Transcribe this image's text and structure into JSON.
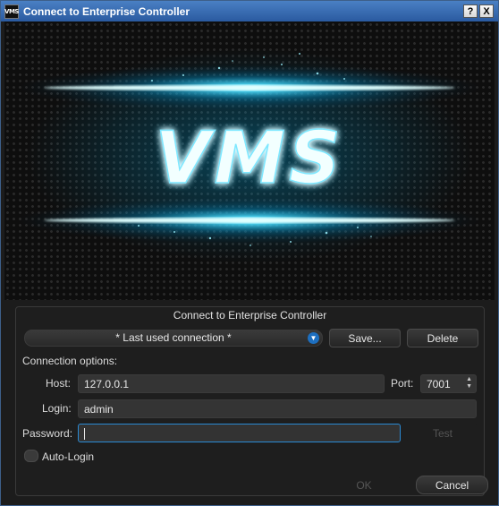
{
  "window": {
    "title": "Connect to Enterprise Controller",
    "app_icon_text": "VMS",
    "help_button": "?",
    "close_button": "X"
  },
  "banner": {
    "logo_text": "VMS"
  },
  "dialog": {
    "header": "Connect to Enterprise Controller",
    "connection_select": "* Last used connection *",
    "save_label": "Save...",
    "delete_label": "Delete",
    "options_label": "Connection options:",
    "host_label": "Host:",
    "host_value": "127.0.0.1",
    "port_label": "Port:",
    "port_value": "7001",
    "login_label": "Login:",
    "login_value": "admin",
    "password_label": "Password:",
    "password_value": "",
    "test_label": "Test",
    "autologin_label": "Auto-Login",
    "ok_label": "OK",
    "cancel_label": "Cancel"
  },
  "colors": {
    "accent": "#00b4ff",
    "titlebar": "#3a6fb4",
    "focus": "#2a8ad4"
  }
}
